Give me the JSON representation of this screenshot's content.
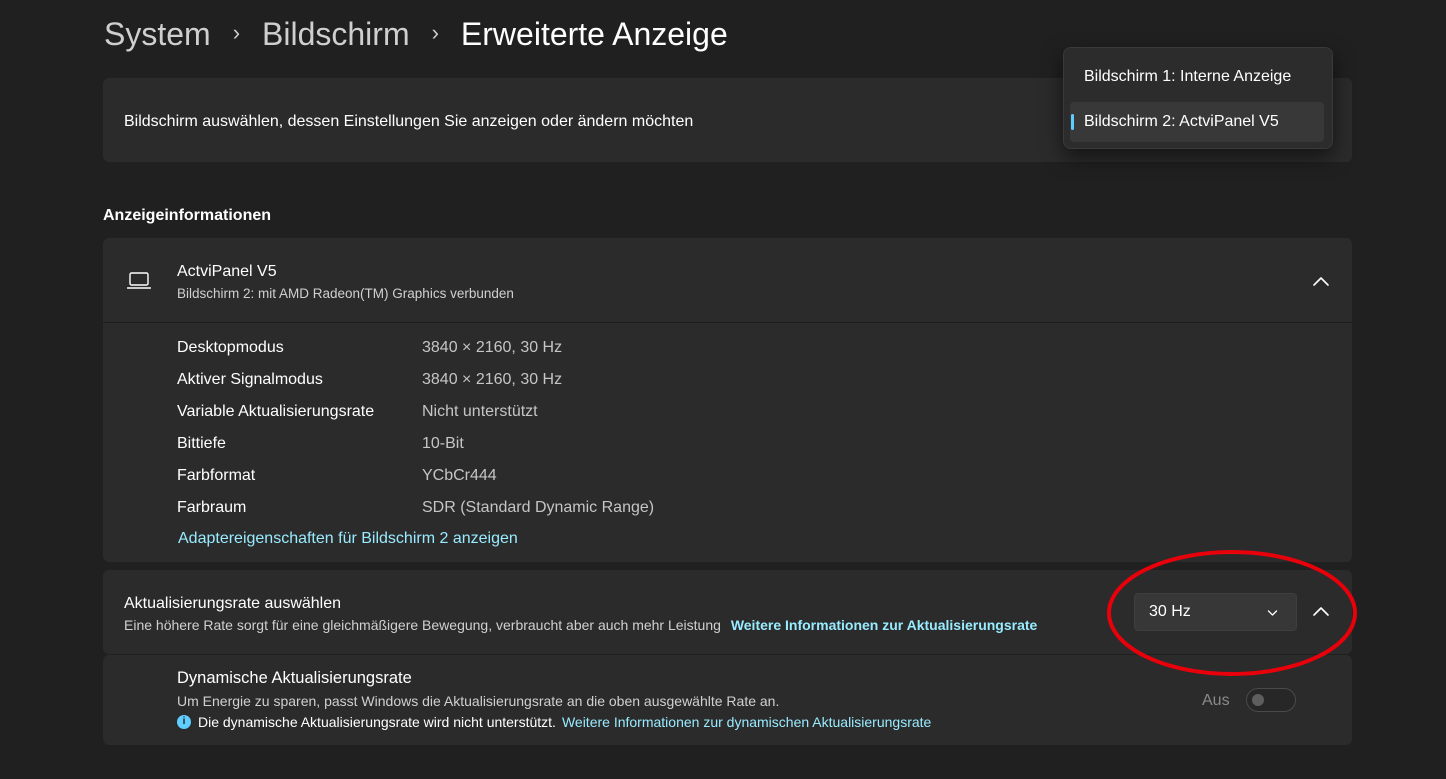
{
  "breadcrumb": {
    "items": [
      "System",
      "Bildschirm"
    ],
    "current": "Erweiterte Anzeige"
  },
  "select_display": {
    "label": "Bildschirm auswählen, dessen Einstellungen Sie anzeigen oder ändern möchten",
    "options": [
      "Bildschirm 1: Interne Anzeige",
      "Bildschirm 2: ActviPanel V5"
    ],
    "selected": "Bildschirm 2: ActviPanel V5"
  },
  "section_title": "Anzeigeinformationen",
  "display_info": {
    "name": "ActviPanel V5",
    "subtitle": "Bildschirm 2: mit AMD Radeon(TM) Graphics verbunden",
    "rows": [
      {
        "label": "Desktopmodus",
        "value": "3840 × 2160, 30 Hz"
      },
      {
        "label": "Aktiver Signalmodus",
        "value": "3840 × 2160, 30 Hz"
      },
      {
        "label": "Variable Aktualisierungsrate",
        "value": "Nicht unterstützt"
      },
      {
        "label": "Bittiefe",
        "value": "10-Bit"
      },
      {
        "label": "Farbformat",
        "value": "YCbCr444"
      },
      {
        "label": "Farbraum",
        "value": "SDR (Standard Dynamic Range)"
      }
    ],
    "adapter_link": "Adaptereigenschaften für Bildschirm 2 anzeigen"
  },
  "refresh_rate": {
    "title": "Aktualisierungsrate auswählen",
    "description": "Eine höhere Rate sorgt für eine gleichmäßigere Bewegung, verbraucht aber auch mehr Leistung",
    "link": "Weitere Informationen zur Aktualisierungsrate",
    "value": "30 Hz"
  },
  "dynamic_rate": {
    "title": "Dynamische Aktualisierungsrate",
    "description": "Um Energie zu sparen, passt Windows die Aktualisierungsrate an die oben ausgewählte Rate an.",
    "note": "Die dynamische Aktualisierungsrate wird nicht unterstützt.",
    "link": "Weitere Informationen zur dynamischen Aktualisierungsrate",
    "toggle_label": "Aus",
    "toggle_on": false
  },
  "colors": {
    "accent": "#60cdff",
    "link": "#99ebff",
    "annotation": "#e8000b"
  }
}
